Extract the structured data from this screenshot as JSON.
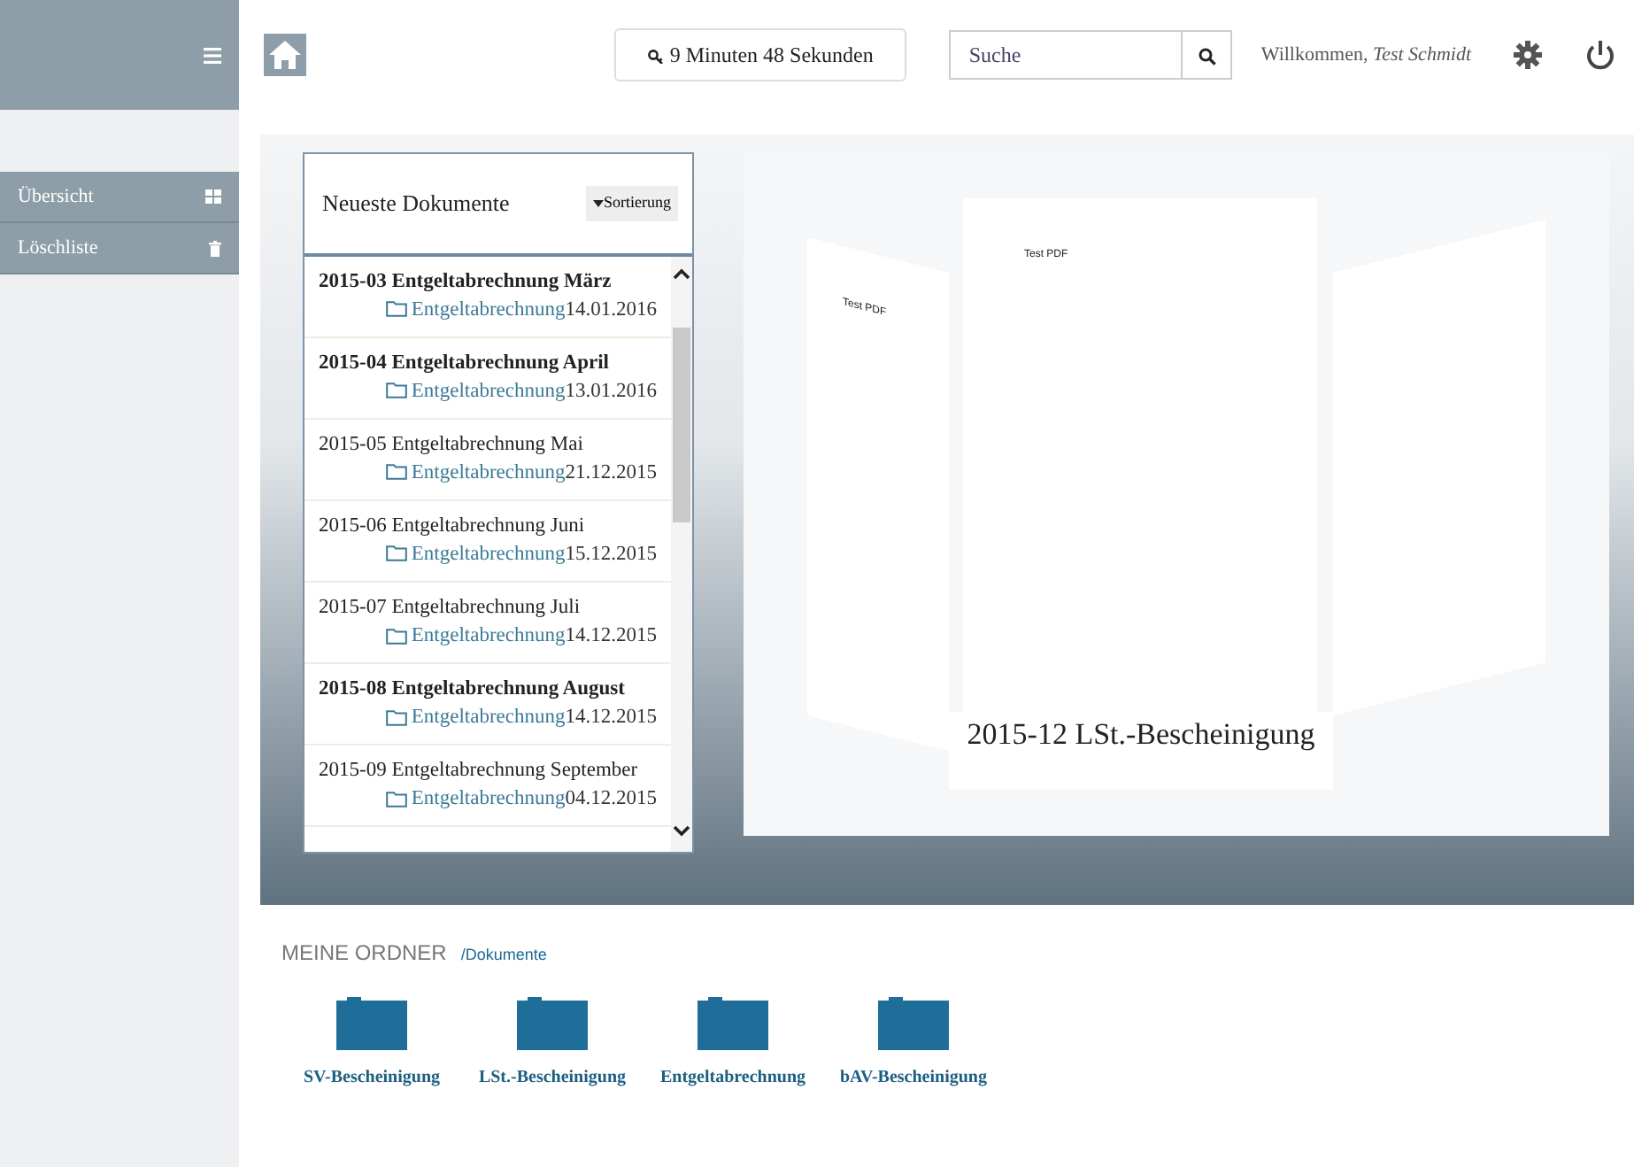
{
  "header": {
    "timer": "9 Minuten 48 Sekunden",
    "search": {
      "placeholder": "Suche"
    },
    "welcome": "Willkommen,",
    "user": "Test Schmidt"
  },
  "sidebar": {
    "items": [
      {
        "label": "Übersicht",
        "kind": "grid"
      },
      {
        "label": "Löschliste",
        "kind": "trash"
      }
    ]
  },
  "documents": {
    "title": "Neueste Dokumente",
    "sort": "Sortierung",
    "items": [
      {
        "title": "2015-03 Entgeltabrechnung März",
        "folder": "Entgeltabrechnung",
        "date": "14.01.2016",
        "unread": true
      },
      {
        "title": "2015-04 Entgeltabrechnung April",
        "folder": "Entgeltabrechnung",
        "date": "13.01.2016",
        "unread": true
      },
      {
        "title": "2015-05 Entgeltabrechnung Mai",
        "folder": "Entgeltabrechnung",
        "date": "21.12.2015",
        "unread": false
      },
      {
        "title": "2015-06 Entgeltabrechnung Juni",
        "folder": "Entgeltabrechnung",
        "date": "15.12.2015",
        "unread": false
      },
      {
        "title": "2015-07 Entgeltabrechnung Juli",
        "folder": "Entgeltabrechnung",
        "date": "14.12.2015",
        "unread": false
      },
      {
        "title": "2015-08 Entgeltabrechnung August",
        "folder": "Entgeltabrechnung",
        "date": "14.12.2015",
        "unread": true
      },
      {
        "title": "2015-09 Entgeltabrechnung September",
        "folder": "Entgeltabrechnung",
        "date": "04.12.2015",
        "unread": false
      }
    ]
  },
  "preview": {
    "pages": [
      {
        "label": "Test PDF"
      },
      {
        "label": "Test PDF"
      }
    ],
    "caption": "2015-12 LSt.-Bescheinigung"
  },
  "folders": {
    "title": "MEINE ORDNER",
    "path": "/Dokumente",
    "items": [
      {
        "label": "SV-Bescheinigung"
      },
      {
        "label": "LSt.-Bescheinigung"
      },
      {
        "label": "Entgeltabrechnung"
      },
      {
        "label": "bAV-Bescheinigung"
      }
    ]
  }
}
